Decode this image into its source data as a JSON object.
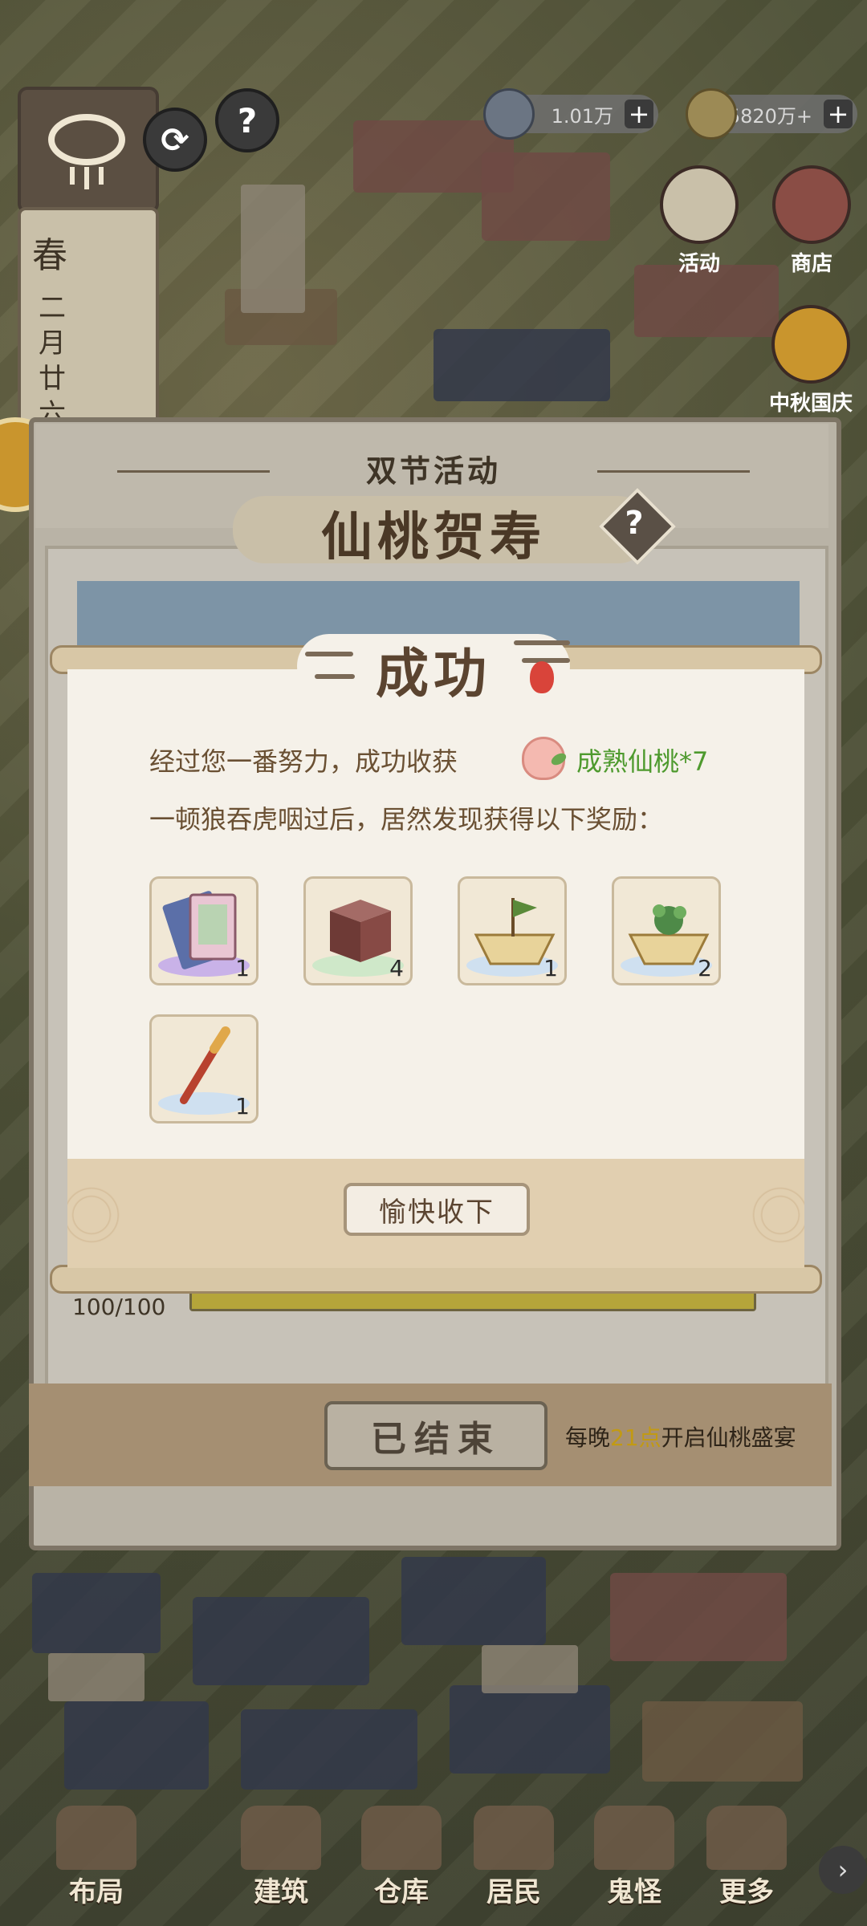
{
  "hud": {
    "season": "春",
    "date": "二月廿六",
    "resources": [
      {
        "icon": "jade-cup-icon",
        "value": "1.01万"
      },
      {
        "icon": "copper-coin-icon",
        "value": "5820万+"
      }
    ],
    "plus_label": "+",
    "help_label": "?",
    "side_buttons": [
      {
        "label": "活动",
        "icon": "activity-scroll-icon"
      },
      {
        "label": "商店",
        "icon": "shop-icon"
      },
      {
        "label": "中秋国庆",
        "icon": "mid-autumn-icon"
      }
    ]
  },
  "event": {
    "subtitle": "双节活动",
    "title": "仙桃贺寿",
    "help": "?",
    "progress": "100/100",
    "progress_fraction": 1.0,
    "ended_button": "已结束",
    "footer_note_prefix": "每晚",
    "footer_note_highlight": "21点",
    "footer_note_suffix": "开启仙桃盛宴"
  },
  "success": {
    "title": "成功",
    "line1": "经过您一番努力，成功收获",
    "reward_name": "成熟仙桃*7",
    "line2": "一顿狼吞虎咽过后，居然发现获得以下奖励：",
    "items": [
      {
        "name": "portrait-book",
        "quantity": "1",
        "pad": "#c9b2e8"
      },
      {
        "name": "brown-block",
        "quantity": "4",
        "pad": "#cfe8c9"
      },
      {
        "name": "banner-boat",
        "quantity": "1",
        "pad": "#cfe0f0"
      },
      {
        "name": "jade-boat",
        "quantity": "2",
        "pad": "#cfe0f0"
      },
      {
        "name": "red-staff",
        "quantity": "1",
        "pad": "#cfe0f0"
      }
    ],
    "accept_button": "愉快收下"
  },
  "nav": {
    "items": [
      "布局",
      "建筑",
      "仓库",
      "居民",
      "鬼怪",
      "更多"
    ],
    "next": "›"
  },
  "colors": {
    "reward_green": "#4e9a2e",
    "highlight_gold": "#c29a13",
    "panel_cream": "#f5f1e9"
  }
}
